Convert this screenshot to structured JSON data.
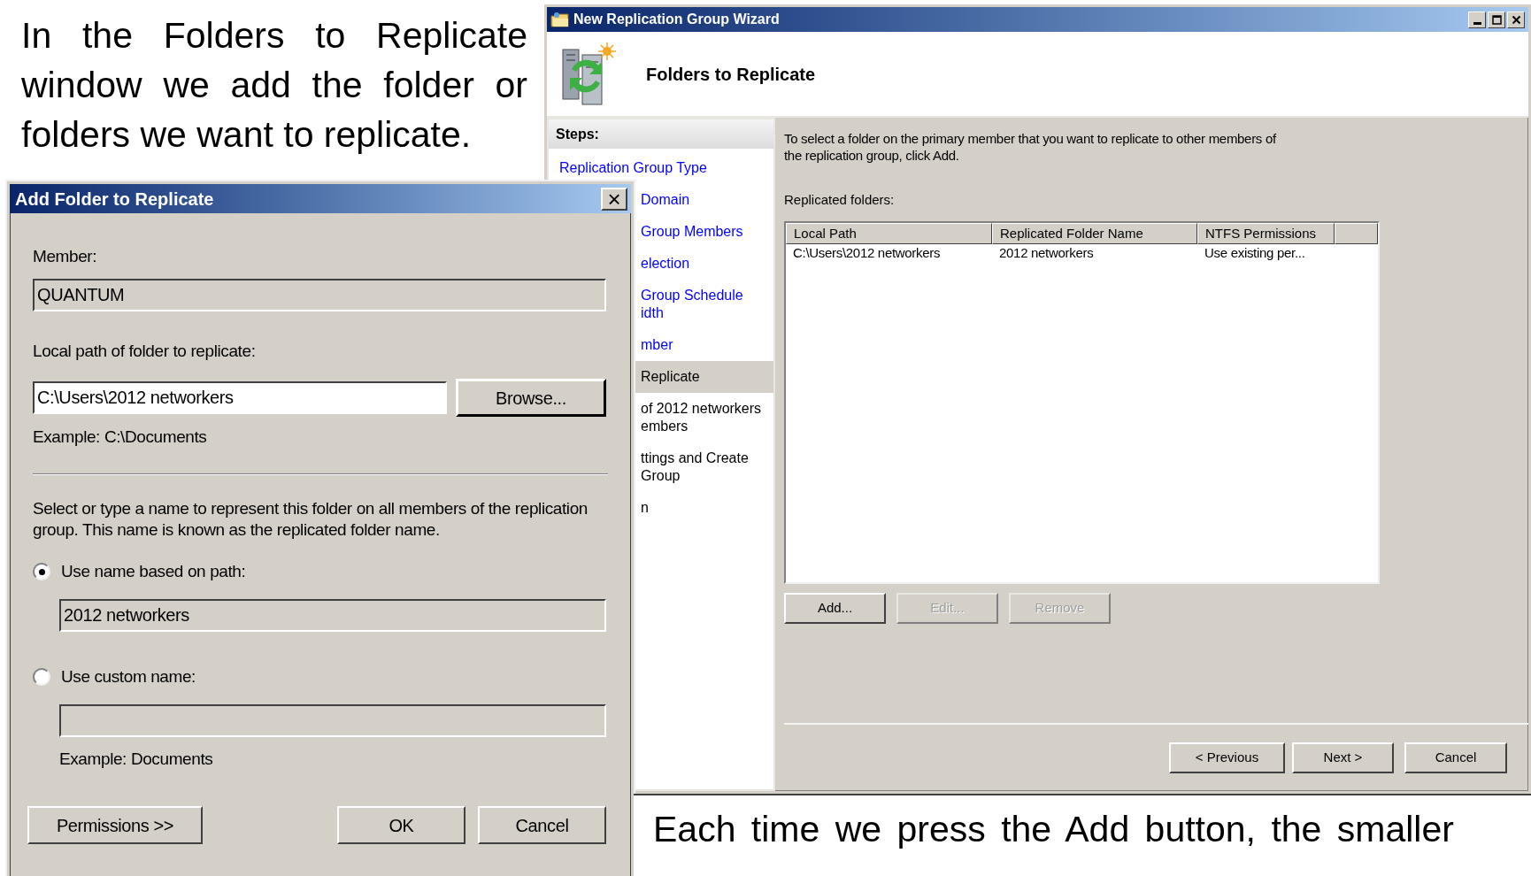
{
  "captions": [
    {
      "text": "In the Folders to Replicate window we add the folder or folders we want to replicate."
    },
    {
      "text": "Each time we press the Add button, the smaller"
    }
  ],
  "wizard": {
    "title": "New Replication Group Wizard",
    "header": "Folders to Replicate",
    "steps_label": "Steps:",
    "steps": [
      {
        "lines": [
          "Replication Group Type"
        ],
        "done": true,
        "selected": false
      },
      {
        "lines": [
          "Domain"
        ],
        "done": true,
        "selected": false
      },
      {
        "lines": [
          "Group Members"
        ],
        "done": true,
        "selected": false
      },
      {
        "lines": [
          "election"
        ],
        "done": true,
        "selected": false
      },
      {
        "lines": [
          "Group Schedule",
          "idth"
        ],
        "done": true,
        "selected": false
      },
      {
        "lines": [
          "mber"
        ],
        "done": true,
        "selected": false
      },
      {
        "lines": [
          "Replicate"
        ],
        "done": false,
        "selected": true
      },
      {
        "lines": [
          "of 2012 networkers",
          "embers"
        ],
        "done": false,
        "selected": false
      },
      {
        "lines": [
          "ttings and Create",
          "Group"
        ],
        "done": false,
        "selected": false
      },
      {
        "lines": [
          "n"
        ],
        "done": false,
        "selected": false
      }
    ],
    "instruction": "To select a folder on the primary member that you want to replicate to other members of the replication group, click Add.",
    "list_label": "Replicated folders:",
    "columns": [
      "Local Path",
      "Replicated Folder Name",
      "NTFS Permissions"
    ],
    "rows": [
      [
        "C:\\Users\\2012 networkers",
        "2012 networkers",
        "Use existing per..."
      ]
    ],
    "list_buttons": [
      {
        "label": "Add...",
        "disabled": false
      },
      {
        "label": "Edit...",
        "disabled": true
      },
      {
        "label": "Remove",
        "disabled": true
      }
    ],
    "nav_buttons": [
      {
        "label": "< Previous",
        "disabled": false
      },
      {
        "label": "Next >",
        "disabled": false
      },
      {
        "label": "Cancel",
        "disabled": false
      }
    ]
  },
  "dialog": {
    "title": "Add Folder to Replicate",
    "close": "×",
    "member_label": "Member:",
    "member_field": {
      "value": "QUANTUM",
      "readonly": true
    },
    "path_label": "Local path of folder to replicate:",
    "path_field": {
      "value": "C:\\Users\\2012 networkers",
      "readonly": false
    },
    "browse_button": "Browse...",
    "path_example": "Example: C:\\Documents",
    "description": "Select or type a name to represent this folder on all members of the replication group. This name is known as the replicated folder name.",
    "options": [
      {
        "label": "Use name based on path:",
        "selected": true,
        "field": {
          "value": "2012 networkers",
          "readonly": true
        }
      },
      {
        "label": "Use custom name:",
        "selected": false,
        "field": {
          "readonly": true
        }
      }
    ],
    "name_example": "Example: Documents",
    "buttons": [
      {
        "label": "Permissions >>",
        "kind": "left"
      },
      {
        "label": "OK",
        "kind": "right"
      },
      {
        "label": "Cancel",
        "kind": "right"
      }
    ]
  }
}
